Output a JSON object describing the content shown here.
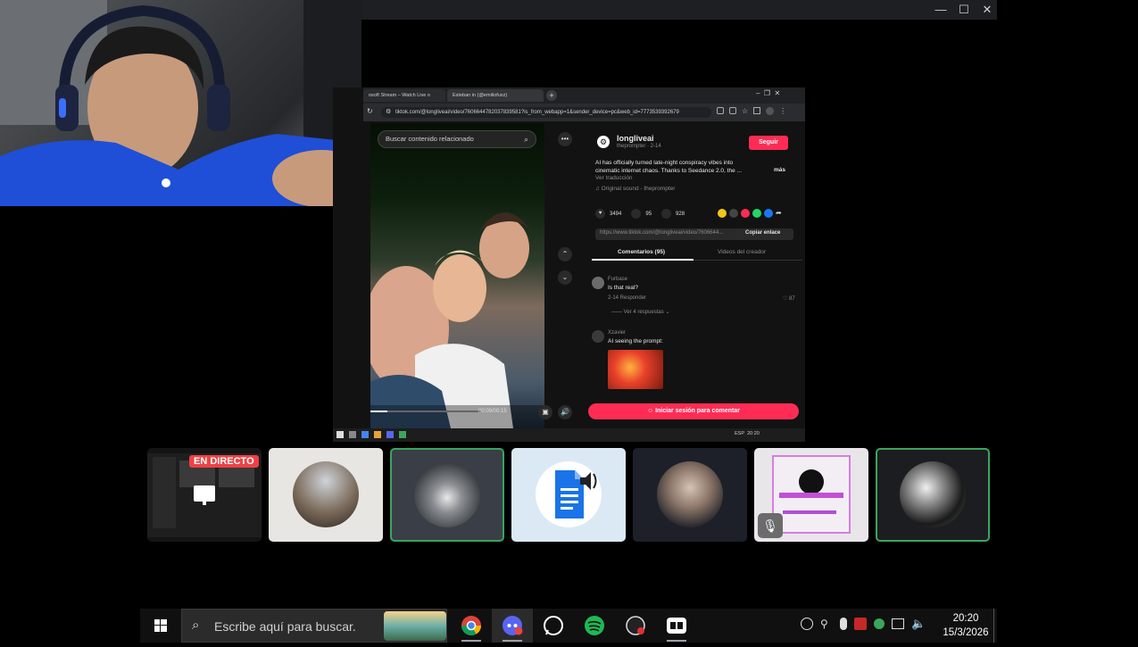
{
  "window": {
    "minimize": "—",
    "maximize": "☐",
    "close": "✕"
  },
  "browser": {
    "tabs": [
      {
        "label": "osoft Stream – Watch Live o"
      },
      {
        "label": "Esteban in (@emiliofuxz)"
      }
    ],
    "url": "tiktok.com/@longliveai/video/7606644782037839581?is_from_webapp=1&sender_device=pc&web_id=7773539392679"
  },
  "tiktok": {
    "search_placeholder": "Buscar contenido relacionado",
    "creator": {
      "name": "longliveai",
      "handle": "theprompter · 2-14",
      "follow_label": "Seguir",
      "caption": "AI has officially turned late-night conspiracy vibes into cinematic internet chaos. Thanks to Seedance 2.0, the ...",
      "more_label": "más",
      "translate_label": "Ver traducción",
      "sound": "♫ Original sound - theprompter"
    },
    "stats": {
      "likes": "3494",
      "comments": "95",
      "saves": "928"
    },
    "share_link": "https://www.tiktok.com/@longliveai/video/7606644...",
    "copy_link_label": "Copiar enlace",
    "tabs": [
      {
        "label": "Comentarios (95)"
      },
      {
        "label": "Videos del creador"
      }
    ],
    "comments": [
      {
        "user": "Furbase",
        "text": "Is that real?",
        "meta": "2-14  Responder",
        "likes": "87",
        "replies_label": "Ver 4 respuestas"
      },
      {
        "user": "Xzavier",
        "text": "AI seeing the prompt:"
      }
    ],
    "video_time": "00:09/00:15",
    "login_comment_label": "Iniciar sesión para comentar"
  },
  "tiles": [
    {
      "live_label": "EN DIRECTO"
    }
  ],
  "taskbar": {
    "search_placeholder": "Escribe aquí para buscar.",
    "time": "20:20",
    "date": "15/3/2026"
  },
  "shared_taskbar": {
    "lang": "ESP",
    "time": "20:20"
  },
  "colors": {
    "tiktok_accent": "#fe2c55",
    "speaking": "#3ba55d",
    "live_red": "#ed4245"
  }
}
